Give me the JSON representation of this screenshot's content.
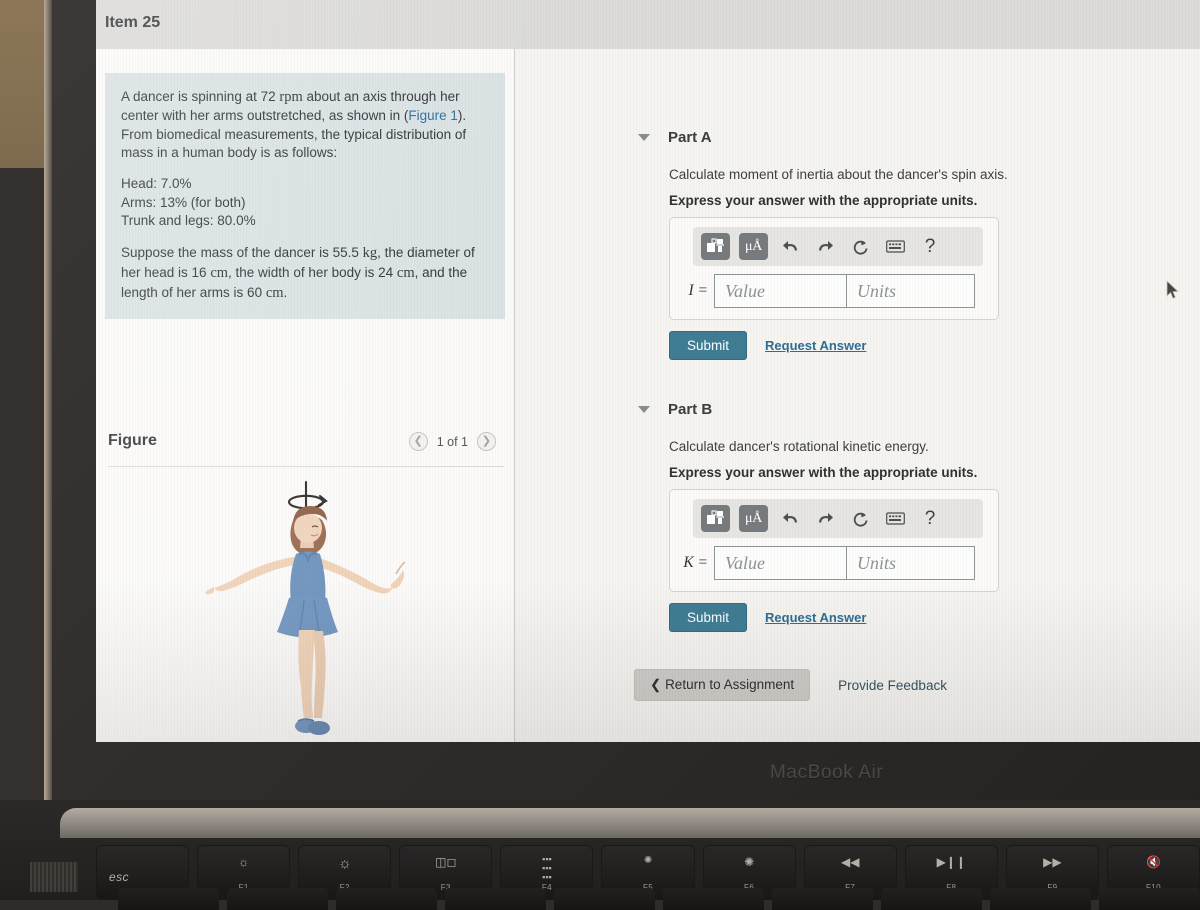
{
  "header": {
    "item_title": "Item 25"
  },
  "problem": {
    "para1_a": "A dancer is spinning at 72 ",
    "para1_rpm": "rpm",
    "para1_b": " about an axis through her center with her arms outstretched, as shown in (",
    "figure_link": "Figure 1",
    "para1_c": "). From biomedical measurements, the typical distribution of mass in a human body is as follows:",
    "head_line": "Head: 7.0%",
    "arms_line": "Arms: 13% (for both)",
    "trunk_line": "Trunk and legs: 80.0%",
    "para2_a": "Suppose the mass of the dancer is 55.5 ",
    "para2_kg": "kg",
    "para2_b": ", the diameter of her head is 16 ",
    "para2_cm1": "cm",
    "para2_c": ", the width of her body is 24 ",
    "para2_cm2": "cm",
    "para2_d": ", and the length of her arms is 60 ",
    "para2_cm3": "cm",
    "para2_e": "."
  },
  "figure": {
    "title": "Figure",
    "pager_count": "1 of 1",
    "prev_icon": "chevron-left-icon",
    "next_icon": "chevron-right-icon",
    "alt": "dancer-spinning-illustration"
  },
  "parts": [
    {
      "id": "A",
      "label": "Part A",
      "prompt": "Calculate moment of inertia about the dancer's spin axis.",
      "express": "Express your answer with the appropriate units.",
      "symbol": "I =",
      "value_placeholder": "Value",
      "units_placeholder": "Units",
      "submit_label": "Submit",
      "request_label": "Request Answer"
    },
    {
      "id": "B",
      "label": "Part B",
      "prompt": "Calculate dancer's rotational kinetic energy.",
      "express": "Express your answer with the appropriate units.",
      "symbol": "K =",
      "value_placeholder": "Value",
      "units_placeholder": "Units",
      "submit_label": "Submit",
      "request_label": "Request Answer"
    }
  ],
  "toolbar": {
    "template_icon": "math-template-icon",
    "units_icon": "micro-angstrom-units-icon",
    "units_label": "μÅ",
    "undo_icon": "undo-arrow-icon",
    "redo_icon": "redo-arrow-icon",
    "reset_icon": "reset-circular-arrow-icon",
    "keyboard_icon": "keyboard-icon",
    "help_icon": "help-question-icon",
    "help_label": "?"
  },
  "footer": {
    "return_label": "Return to Assignment",
    "return_icon": "chevron-left-icon",
    "feedback_label": "Provide Feedback"
  },
  "device": {
    "bezel_label": "MacBook Air",
    "keys": [
      {
        "label": "esc",
        "glyph": ""
      },
      {
        "label": "F1",
        "glyph": "brightness-down-icon"
      },
      {
        "label": "F2",
        "glyph": "brightness-up-icon"
      },
      {
        "label": "F3",
        "glyph": "mission-control-icon"
      },
      {
        "label": "F4",
        "glyph": "launchpad-icon"
      },
      {
        "label": "F5",
        "glyph": "keyboard-backlight-down-icon"
      },
      {
        "label": "F6",
        "glyph": "keyboard-backlight-up-icon"
      },
      {
        "label": "F7",
        "glyph": "rewind-icon"
      },
      {
        "label": "F8",
        "glyph": "play-pause-icon"
      },
      {
        "label": "F9",
        "glyph": "fast-forward-icon"
      },
      {
        "label": "F10",
        "glyph": "mute-icon"
      }
    ]
  },
  "colors": {
    "submit": "#3f7d94",
    "link": "#2d6f93",
    "problem_card": "#dae2e4",
    "header_bar": "#dcdbd8"
  }
}
